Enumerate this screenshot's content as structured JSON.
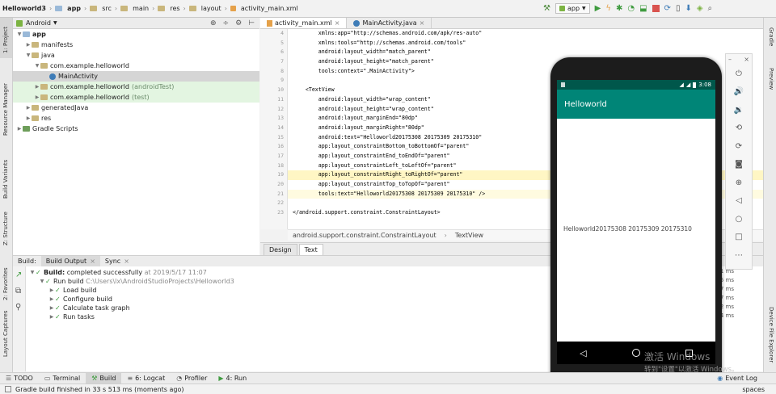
{
  "toolbar": {
    "breadcrumbs": [
      "Helloworld3",
      "app",
      "src",
      "main",
      "res",
      "layout",
      "activity_main.xml"
    ],
    "run_config": "app"
  },
  "left_strip": {
    "items": [
      "1: Project",
      "Resource Manager",
      "Build Variants",
      "Z: Structure",
      "2: Favorites",
      "Layout Captures"
    ]
  },
  "right_strip": {
    "items": [
      "Gradle",
      "Preview",
      "Device File Explorer"
    ]
  },
  "project": {
    "view_mode": "Android",
    "tree": [
      {
        "label": "app",
        "depth": 0,
        "kind": "module",
        "bold": true
      },
      {
        "label": "manifests",
        "depth": 1,
        "kind": "folder"
      },
      {
        "label": "java",
        "depth": 1,
        "kind": "folder"
      },
      {
        "label": "com.example.helloworld",
        "depth": 2,
        "kind": "package"
      },
      {
        "label": "MainActivity",
        "depth": 3,
        "kind": "class",
        "selected": true
      },
      {
        "label": "com.example.helloworld",
        "suffix": "(androidTest)",
        "depth": 2,
        "kind": "package",
        "green": true
      },
      {
        "label": "com.example.helloworld",
        "suffix": "(test)",
        "depth": 2,
        "kind": "package",
        "green": true
      },
      {
        "label": "generatedJava",
        "depth": 1,
        "kind": "folder"
      },
      {
        "label": "res",
        "depth": 1,
        "kind": "folder"
      },
      {
        "label": "Gradle Scripts",
        "depth": 0,
        "kind": "gradle"
      }
    ]
  },
  "editor": {
    "tabs": [
      {
        "label": "activity_main.xml",
        "active": true
      },
      {
        "label": "MainActivity.java",
        "active": false
      }
    ],
    "line_numbers": [
      "4",
      "5",
      "6",
      "7",
      "8",
      "9",
      "10",
      "11",
      "12",
      "13",
      "14",
      "15",
      "16",
      "17",
      "18",
      "19",
      "20",
      "21",
      "22",
      "23"
    ],
    "lines": [
      "        xmlns:app=\"http://schemas.android.com/apk/res-auto\"",
      "        xmlns:tools=\"http://schemas.android.com/tools\"",
      "        android:layout_width=\"match_parent\"",
      "        android:layout_height=\"match_parent\"",
      "        tools:context=\".MainActivity\">",
      "",
      "    <TextView",
      "        android:layout_width=\"wrap_content\"",
      "        android:layout_height=\"wrap_content\"",
      "        android:layout_marginEnd=\"80dp\"",
      "        android:layout_marginRight=\"80dp\"",
      "        android:text=\"Helloworld20175308 20175309 20175310\"",
      "        app:layout_constraintBottom_toBottomOf=\"parent\"",
      "        app:layout_constraintEnd_toEndOf=\"parent\"",
      "        app:layout_constraintLeft_toLeftOf=\"parent\"",
      "        app:layout_constraintRight_toRightOf=\"parent\"",
      "        app:layout_constraintTop_toTopOf=\"parent\"",
      "        tools:text=\"Helloworld20175308 20175309 20175310\" />",
      "",
      "</android.support.constraint.ConstraintLayout>"
    ],
    "breadcrumb": [
      "android.support.constraint.ConstraintLayout",
      "TextView"
    ],
    "design_tabs": [
      {
        "label": "Design",
        "active": false
      },
      {
        "label": "Text",
        "active": true
      }
    ]
  },
  "build": {
    "label": "Build:",
    "tabs": [
      {
        "label": "Build Output",
        "active": true
      },
      {
        "label": "Sync",
        "active": false
      }
    ],
    "rows": [
      {
        "depth": 0,
        "bold_prefix": "Build:",
        "text": " completed successfully",
        "gray": " at 2019/5/17 11:07",
        "duration": "33 s 511 ms"
      },
      {
        "depth": 1,
        "text": "Run build",
        "gray": " C:\\Users\\lx\\AndroidStudioProjects\\Helloworld3",
        "duration": "33 s 225 ms"
      },
      {
        "depth": 2,
        "text": "Load build",
        "duration": "7 ms"
      },
      {
        "depth": 2,
        "text": "Configure build",
        "duration": "347 ms"
      },
      {
        "depth": 2,
        "text": "Calculate task graph",
        "duration": "22 ms"
      },
      {
        "depth": 2,
        "text": "Run tasks",
        "duration": "32 s 784 ms"
      }
    ]
  },
  "bottom_tabs": [
    {
      "label": "TODO",
      "active": false
    },
    {
      "label": "Terminal",
      "active": false
    },
    {
      "label": "Build",
      "active": true
    },
    {
      "label": "6: Logcat",
      "active": false
    },
    {
      "label": "Profiler",
      "active": false
    },
    {
      "label": "4: Run",
      "active": false
    }
  ],
  "bottom_right_tab": "Event Log",
  "status": {
    "message": "Gradle build finished in 33 s 513 ms (moments ago)",
    "right": "spaces"
  },
  "emulator": {
    "time": "3:08",
    "app_title": "Helloworld",
    "content_text": "Helloworld20175308 20175309 20175310",
    "panel_icons": [
      "close-icon",
      "minimize-icon",
      "power-icon",
      "volume-up-icon",
      "volume-down-icon",
      "rotate-left-icon",
      "rotate-right-icon",
      "camera-icon",
      "zoom-icon",
      "back-icon",
      "home-icon",
      "overview-icon",
      "more-icon"
    ]
  },
  "watermark": {
    "line1": "激活 Windows",
    "line2": "转到\"设置\"以激活 Windows。"
  }
}
